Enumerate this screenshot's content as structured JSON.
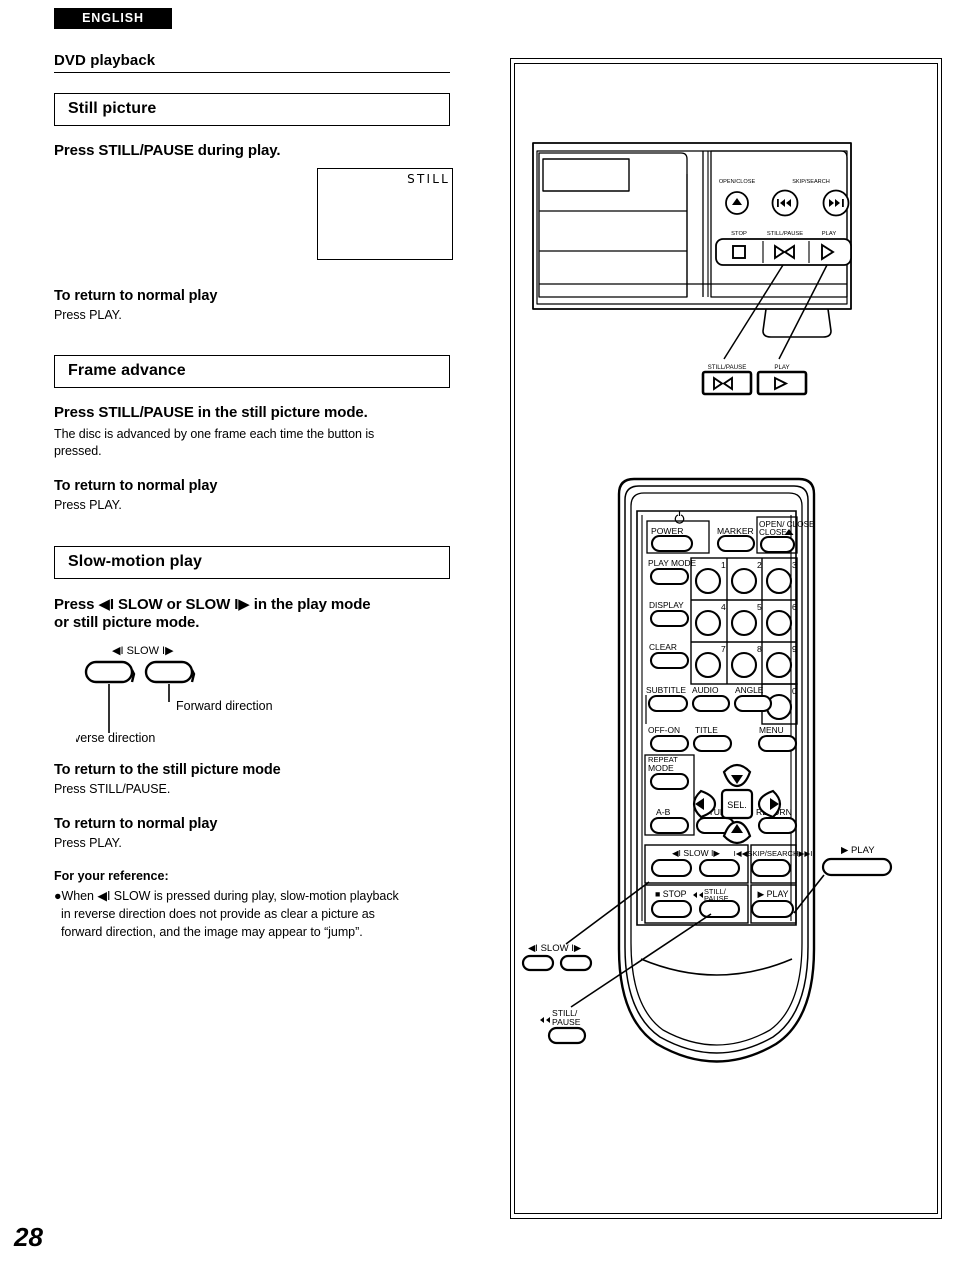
{
  "page": {
    "language_badge": "ENGLISH",
    "section_title": "DVD playback",
    "page_number": "28"
  },
  "sections": [
    {
      "id": "still-picture",
      "heading": "Still picture",
      "instruction": "Press STILL/PAUSE during play.",
      "screen_label": "STILL",
      "subsections": [
        {
          "title": "To return to normal play",
          "text": "Press PLAY."
        }
      ]
    },
    {
      "id": "frame-advance",
      "heading": "Frame advance",
      "instruction": "Press STILL/PAUSE in the still picture mode.",
      "body": "The disc is advanced by one frame each time the button is pressed.",
      "subsections": [
        {
          "title": "To return to normal play",
          "text": "Press PLAY."
        }
      ]
    },
    {
      "id": "slow-motion-play",
      "heading": "Slow-motion play",
      "instruction_line1": "Press ◀I SLOW or SLOW I▶ in the play mode",
      "instruction_line2": "or still picture mode.",
      "diagram": {
        "caption": "◀I SLOW I▶",
        "forward_label": "Forward direction",
        "reverse_label": "Reverse direction"
      },
      "subsections": [
        {
          "title": "To return to the still picture mode",
          "text": "Press STILL/PAUSE."
        },
        {
          "title": "To return to normal play",
          "text": "Press PLAY."
        }
      ],
      "reference": {
        "title": "For your reference:",
        "bullet": "●When ◀I SLOW is pressed during play, slow-motion playback in reverse direction does not provide as clear a picture as forward direction, and the image may appear to “jump”."
      }
    }
  ],
  "illustration": {
    "front_panel": {
      "labels_top": [
        "OPEN/CLOSE",
        "SKIP/SEARCH"
      ],
      "labels_bottom": [
        "STOP",
        "STILL/PAUSE",
        "PLAY"
      ],
      "callouts": [
        {
          "label": "STILL/PAUSE",
          "icon": "still-pause-icon"
        },
        {
          "label": "PLAY",
          "icon": "play-icon"
        }
      ]
    },
    "remote": {
      "row_power": [
        "POWER",
        "MARKER",
        "OPEN/ CLOSE"
      ],
      "left_column": [
        "PLAY MODE",
        "DISPLAY",
        "CLEAR",
        "SUBTITLE",
        "OFF-ON",
        "REPEAT MODE",
        "A-B"
      ],
      "numeric_keys": [
        "1",
        "2",
        "3",
        "4",
        "5",
        "6",
        "7",
        "8",
        "9",
        "0"
      ],
      "row_subtitle": [
        "SUBTITLE",
        "AUDIO",
        "ANGLE"
      ],
      "row_title": [
        "OFF-ON",
        "TITLE",
        "MENU"
      ],
      "nav": {
        "up": "▲",
        "down": "▼",
        "left": "◀",
        "right": "▶",
        "select": "SEL."
      },
      "row_setup": [
        "REPEAT MODE",
        "SETUP",
        "RETURN"
      ],
      "row_ab": [
        "A-B",
        "SETUP",
        "RETURN"
      ],
      "slow_group": "◀I SLOW I▶",
      "skip_group": "I◀◀SKIP/SEARCH▶▶I",
      "transport": [
        "■ STOP",
        "STILL/ PAUSE",
        "▶ PLAY"
      ]
    },
    "remote_callouts": [
      {
        "label": "▶ PLAY",
        "position": "right"
      },
      {
        "label": "◀I SLOW I▶",
        "position": "lower-left"
      },
      {
        "label": "STILL/ PAUSE",
        "position": "bottom-left"
      }
    ]
  },
  "colors": {
    "ink": "#000000",
    "paper": "#ffffff"
  }
}
